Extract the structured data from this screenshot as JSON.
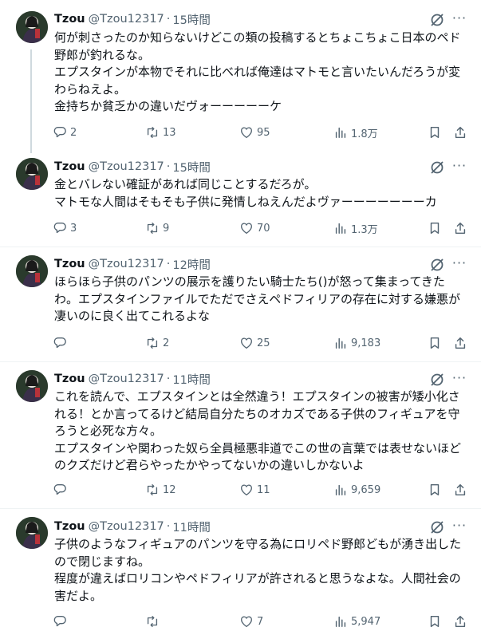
{
  "tweets": [
    {
      "name": "Tzou",
      "handle": "@Tzou12317",
      "separator": "·",
      "time": "15時間",
      "lines": [
        "何が刺さったのか知らないけどこの類の投稿するとちょこちょこ日本のペド",
        "野郎が釣れるな。",
        "エプスタインが本物でそれに比べれば俺達はマトモと言いたいんだろうが変",
        "わらねえよ。",
        "金持ちか貧乏かの違いだヴォーーーーーケ"
      ],
      "replies": "2",
      "retweets": "13",
      "likes": "95",
      "views": "1.8万"
    },
    {
      "name": "Tzou",
      "handle": "@Tzou12317",
      "separator": "·",
      "time": "15時間",
      "lines": [
        "金とバレない確証があれば同じことするだろが。",
        "マトモな人間はそもそも子供に発情しねえんだよヴァーーーーーーーカ"
      ],
      "replies": "3",
      "retweets": "9",
      "likes": "70",
      "views": "1.3万"
    },
    {
      "name": "Tzou",
      "handle": "@Tzou12317",
      "separator": "·",
      "time": "12時間",
      "lines": [
        "ほらほら子供のパンツの展示を護りたい騎士たち()が怒って集まってきた",
        "わ。エプスタインファイルでただでさえペドフィリアの存在に対する嫌悪が",
        "凄いのに良く出てこれるよな"
      ],
      "replies": "",
      "retweets": "2",
      "likes": "25",
      "views": "9,183"
    },
    {
      "name": "Tzou",
      "handle": "@Tzou12317",
      "separator": "·",
      "time": "11時間",
      "lines": [
        "これを読んで、エプスタインとは全然違う！エプスタインの被害が矮小化さ",
        "れる！とか言ってるけど結局自分たちのオカズである子供のフィギュアを守",
        "ろうと必死な方々。",
        "エプスタインや関わった奴ら全員極悪非道でこの世の言葉では表せないほど",
        "のクズだけど君らやったかやってないかの違いしかないよ"
      ],
      "replies": "",
      "retweets": "12",
      "likes": "11",
      "views": "9,659"
    },
    {
      "name": "Tzou",
      "handle": "@Tzou12317",
      "separator": "·",
      "time": "11時間",
      "lines": [
        "子供のようなフィギュアのパンツを守る為にロリペド野郎どもが湧き出した",
        "ので閉じますね。",
        "程度が違えばロリコンやペドフィリアが許されると思うなよな。人間社会の",
        "害だよ。"
      ],
      "replies": "",
      "retweets": "",
      "likes": "7",
      "views": "5,947"
    }
  ]
}
